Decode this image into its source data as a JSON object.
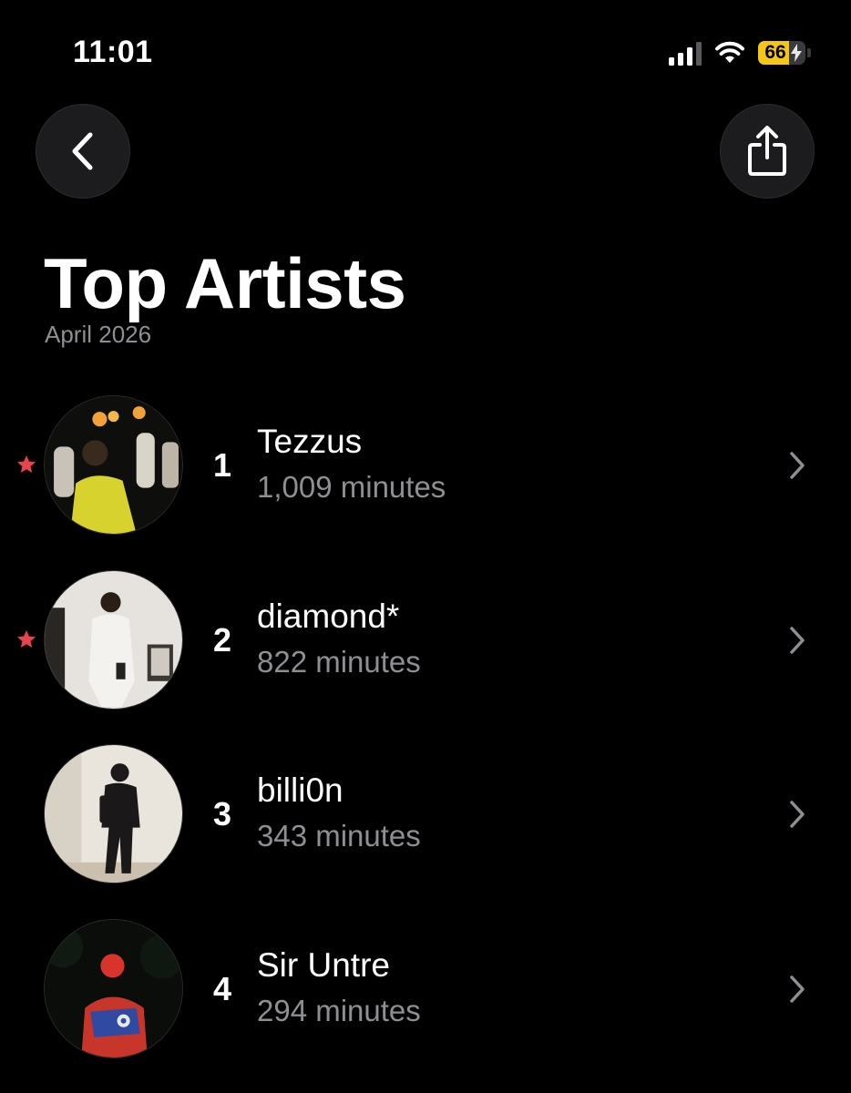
{
  "status_bar": {
    "time": "11:01",
    "battery_percent": "66",
    "battery_level": 0.66,
    "signal_icon": "cellular-signal-icon",
    "wifi_icon": "wifi-icon",
    "battery_color": "#f5c518"
  },
  "nav": {
    "back_icon": "chevron-left-icon",
    "share_icon": "share-icon"
  },
  "header": {
    "title": "Top Artists",
    "subtitle": "April 2026"
  },
  "artists": [
    {
      "rank": "1",
      "name": "Tezzus",
      "minutes": "1,009 minutes",
      "starred": true
    },
    {
      "rank": "2",
      "name": "diamond*",
      "minutes": "822 minutes",
      "starred": true
    },
    {
      "rank": "3",
      "name": "billi0n",
      "minutes": "343 minutes",
      "starred": false
    },
    {
      "rank": "4",
      "name": "Sir Untre",
      "minutes": "294 minutes",
      "starred": false
    }
  ],
  "colors": {
    "background": "#000000",
    "secondary_text": "#8e8e93",
    "star": "#e8434f",
    "button_bg": "#1c1c1e"
  }
}
